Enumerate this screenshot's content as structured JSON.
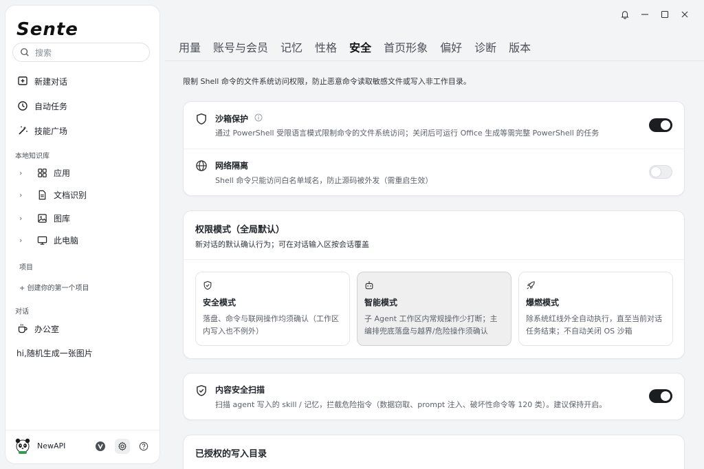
{
  "app": {
    "logo": "Sente"
  },
  "sidebar": {
    "search_placeholder": "搜索",
    "primary": [
      {
        "label": "新建对话",
        "icon": "new-chat-icon"
      },
      {
        "label": "自动任务",
        "icon": "clock-icon"
      },
      {
        "label": "技能广场",
        "icon": "magic-wand-icon"
      }
    ],
    "knowledge_label": "本地知识库",
    "knowledge_items": [
      {
        "label": "应用",
        "icon": "apps-grid-icon"
      },
      {
        "label": "文档识别",
        "icon": "document-icon"
      },
      {
        "label": "图库",
        "icon": "image-icon"
      },
      {
        "label": "此电脑",
        "icon": "monitor-icon"
      }
    ],
    "projects_label": "项目",
    "create_project": "+ 创建你的第一个项目",
    "conversations_label": "对话",
    "conversations": [
      {
        "label": "办公室",
        "icon": "coffee-cup-icon"
      },
      {
        "label": "hi,随机生成一张图片"
      }
    ],
    "footer": {
      "username": "NewAPI"
    }
  },
  "tabs": [
    {
      "label": "用量",
      "active": false
    },
    {
      "label": "账号与会员",
      "active": false
    },
    {
      "label": "记忆",
      "active": false
    },
    {
      "label": "性格",
      "active": false
    },
    {
      "label": "安全",
      "active": true
    },
    {
      "label": "首页形象",
      "active": false
    },
    {
      "label": "偏好",
      "active": false
    },
    {
      "label": "诊断",
      "active": false
    },
    {
      "label": "版本",
      "active": false
    }
  ],
  "security": {
    "intro": "限制 Shell 命令的文件系统访问权限，防止恶意命令读取敏感文件或写入非工作目录。",
    "sandbox": {
      "title": "沙箱保护",
      "desc": "通过 PowerShell 受限语言模式限制命令的文件系统访问；关闭后可运行 Office 生成等需完整 PowerShell 的任务",
      "enabled": true
    },
    "network": {
      "title": "网络隔离",
      "desc": "Shell 命令只能访问白名单域名，防止源码被外发（需重启生效）",
      "enabled": false
    },
    "permission": {
      "title": "权限模式（全局默认）",
      "subtitle": "新对话的默认确认行为；可在对话输入区按会话覆盖",
      "modes": [
        {
          "title": "安全模式",
          "desc": "落盘、命令与联网操作均须确认（工作区内写入也不例外）",
          "icon": "shield-check-icon",
          "selected": false
        },
        {
          "title": "智能模式",
          "desc": "子 Agent 工作区内常规操作少打断；主编排兜底落盘与越界/危险操作须确认",
          "icon": "robot-icon",
          "selected": true
        },
        {
          "title": "爆燃模式",
          "desc": "除系统红线外全自动执行，直至当前对话任务结束；不自动关闭 OS 沙箱",
          "icon": "rocket-icon",
          "selected": false
        }
      ]
    },
    "content_scan": {
      "title": "内容安全扫描",
      "desc": "扫描 agent 写入的 skill / 记忆，拦截危险指令（数据窃取、prompt 注入、破坏性命令等 120 类）。建议保持开启。",
      "enabled": true
    },
    "write_dirs": {
      "title": "已授权的写入目录"
    }
  }
}
